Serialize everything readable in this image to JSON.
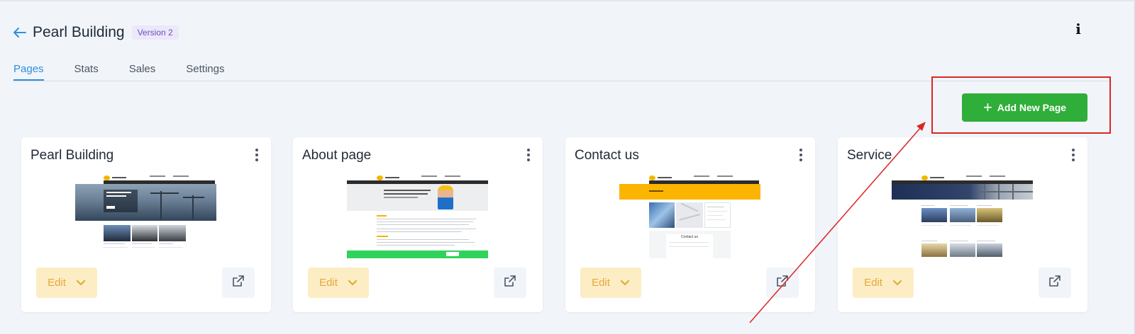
{
  "header": {
    "title": "Pearl Building",
    "version": "Version 2"
  },
  "tabs": [
    {
      "label": "Pages",
      "active": true
    },
    {
      "label": "Stats",
      "active": false
    },
    {
      "label": "Sales",
      "active": false
    },
    {
      "label": "Settings",
      "active": false
    }
  ],
  "actions": {
    "add_page_label": "Add New Page"
  },
  "cards": [
    {
      "title": "Pearl Building",
      "edit_label": "Edit"
    },
    {
      "title": "About page",
      "edit_label": "Edit"
    },
    {
      "title": "Contact us",
      "edit_label": "Edit"
    },
    {
      "title": "Service",
      "edit_label": "Edit"
    }
  ],
  "thumbnails": {
    "contact_heading": "Contact us"
  },
  "colors": {
    "accent": "#2f8ee0",
    "add_button": "#2fae3a",
    "edit_bg": "#fdedc4",
    "edit_text": "#e3aa3a",
    "annotation": "#dc2626"
  },
  "icons": [
    "back-arrow-icon",
    "info-icon",
    "plus-icon",
    "kebab-menu-icon",
    "chevron-down-icon",
    "external-link-icon"
  ]
}
